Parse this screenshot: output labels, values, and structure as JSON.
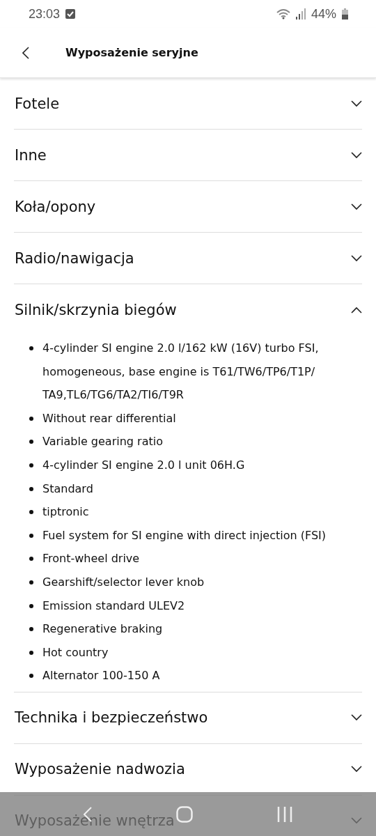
{
  "status_bar": {
    "time": "23:03",
    "battery": "44%"
  },
  "header": {
    "title": "Wyposażenie seryjne"
  },
  "sections": [
    {
      "title": "Fotele",
      "expanded": false
    },
    {
      "title": "Inne",
      "expanded": false
    },
    {
      "title": "Koła/opony",
      "expanded": false
    },
    {
      "title": "Radio/nawigacja",
      "expanded": false
    },
    {
      "title": "Silnik/skrzynia biegów",
      "expanded": true,
      "items": [
        "4-cylinder SI engine 2.0 l/162 kW (16V) turbo FSI, homogeneous, base engine is T61/TW6/TP6/T1P/ TA9,TL6/TG6/TA2/TI6/T9R",
        "Without rear differential",
        "Variable gearing ratio",
        "4-cylinder SI engine 2.0 l unit 06H.G",
        "Standard",
        "tiptronic",
        "Fuel system for SI engine with direct injection (FSI)",
        "Front-wheel drive",
        "Gearshift/selector lever knob",
        "Emission standard ULEV2",
        "Regenerative braking",
        "Hot country",
        "Alternator 100-150 A"
      ]
    },
    {
      "title": "Technika i bezpieczeństwo",
      "expanded": false
    },
    {
      "title": "Wyposażenie nadwozia",
      "expanded": false
    },
    {
      "title": "Wyposażenie wnętrza",
      "expanded": false
    }
  ]
}
